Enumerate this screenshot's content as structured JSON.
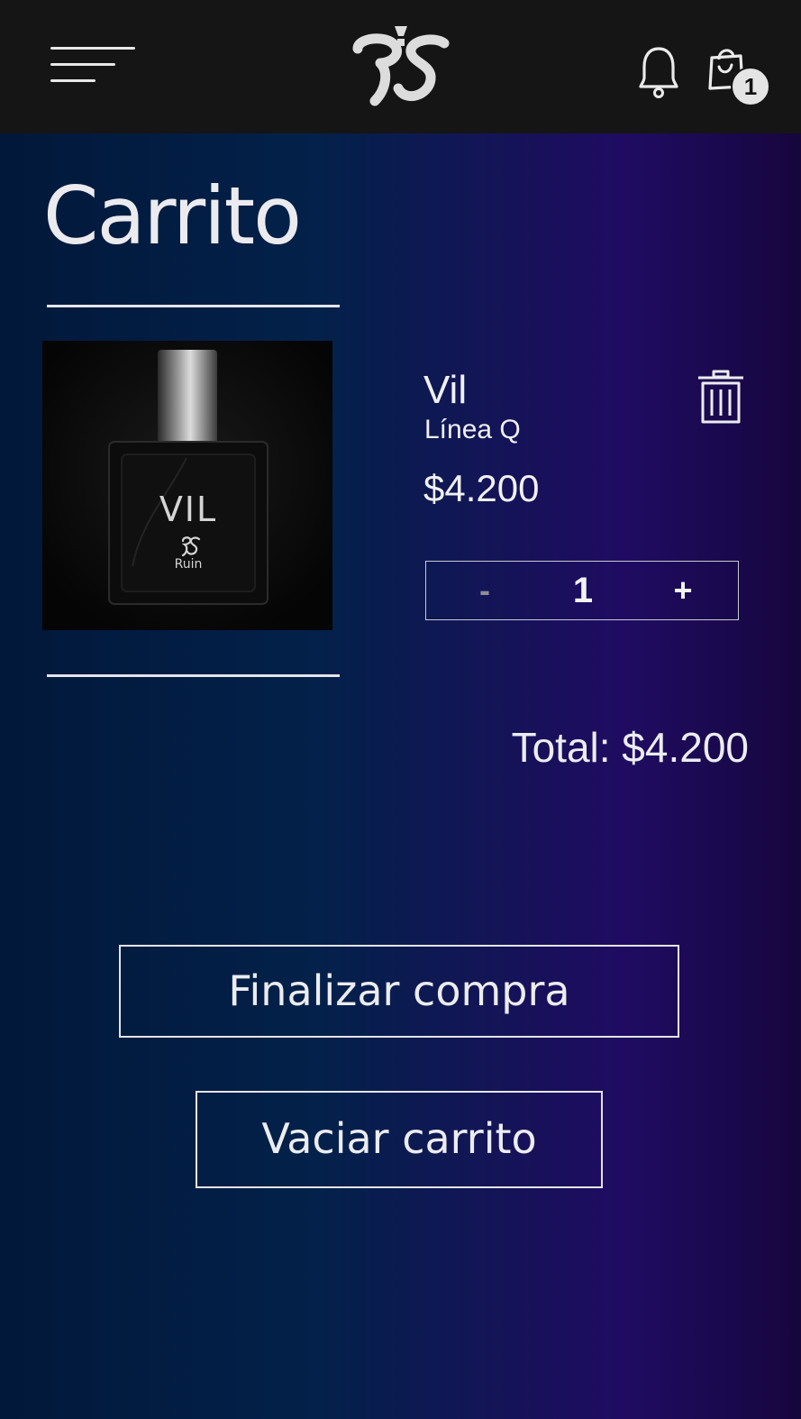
{
  "header": {
    "menu_icon": "hamburger-menu-icon",
    "logo_icon": "brand-logo-icon",
    "notifications_icon": "bell-icon",
    "cart_icon": "shopping-bag-icon",
    "cart_count": "1"
  },
  "page": {
    "title": "Carrito"
  },
  "cart": {
    "items": [
      {
        "image_label": "VIL",
        "image_brand": "Ruin",
        "name": "Vil",
        "line": "Línea Q",
        "price": "$4.200",
        "quantity": "1",
        "decrement_label": "-",
        "increment_label": "+",
        "remove_icon": "trash-icon"
      }
    ],
    "total": "Total: $4.200"
  },
  "actions": {
    "checkout_label": "Finalizar compra",
    "empty_label": "Vaciar carrito"
  },
  "colors": {
    "header_bg": "#151515",
    "gradient_left": "#02183a",
    "gradient_mid": "#1f0c62",
    "gradient_right": "#16063d",
    "text": "#ececf0"
  }
}
